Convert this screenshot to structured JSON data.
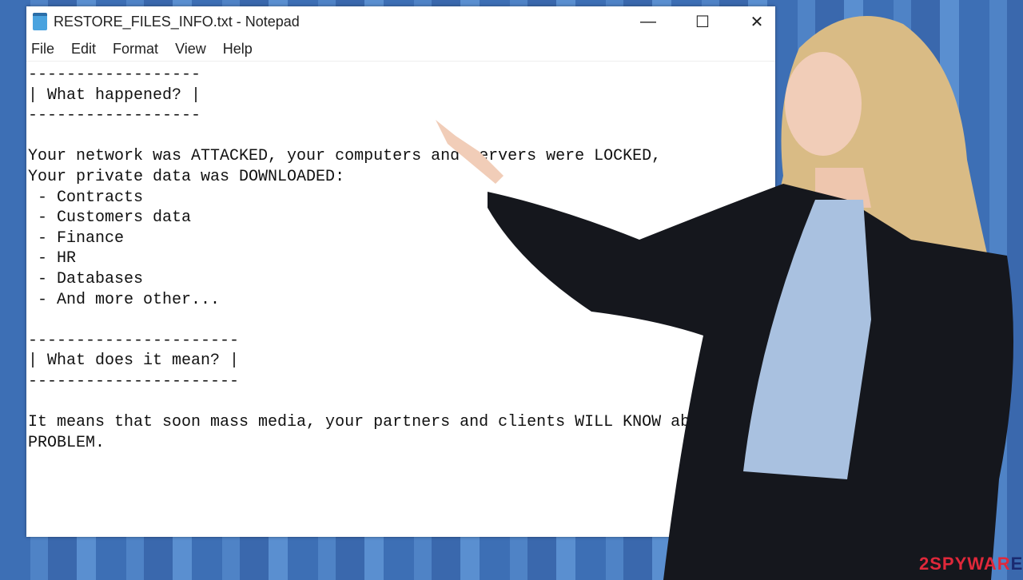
{
  "window": {
    "title": "RESTORE_FILES_INFO.txt - Notepad",
    "icon": "notepad-icon",
    "controls": [
      {
        "name": "minimize",
        "glyph": "—"
      },
      {
        "name": "maximize",
        "glyph": "☐"
      },
      {
        "name": "close",
        "glyph": "✕"
      }
    ]
  },
  "menu": [
    "File",
    "Edit",
    "Format",
    "View",
    "Help"
  ],
  "document": {
    "lines": [
      "------------------",
      "| What happened? |",
      "------------------",
      "",
      "Your network was ATTACKED, your computers and servers were LOCKED,",
      "Your private data was DOWNLOADED:",
      " - Contracts",
      " - Customers data",
      " - Finance",
      " - HR",
      " - Databases",
      " - And more other...",
      "",
      "----------------------",
      "| What does it mean? |",
      "----------------------",
      "",
      "It means that soon mass media, your partners and clients WILL KNOW abo",
      "PROBLEM."
    ]
  },
  "logo": {
    "part1": "2SPY",
    "part2": "WAR",
    "part3": "E"
  }
}
